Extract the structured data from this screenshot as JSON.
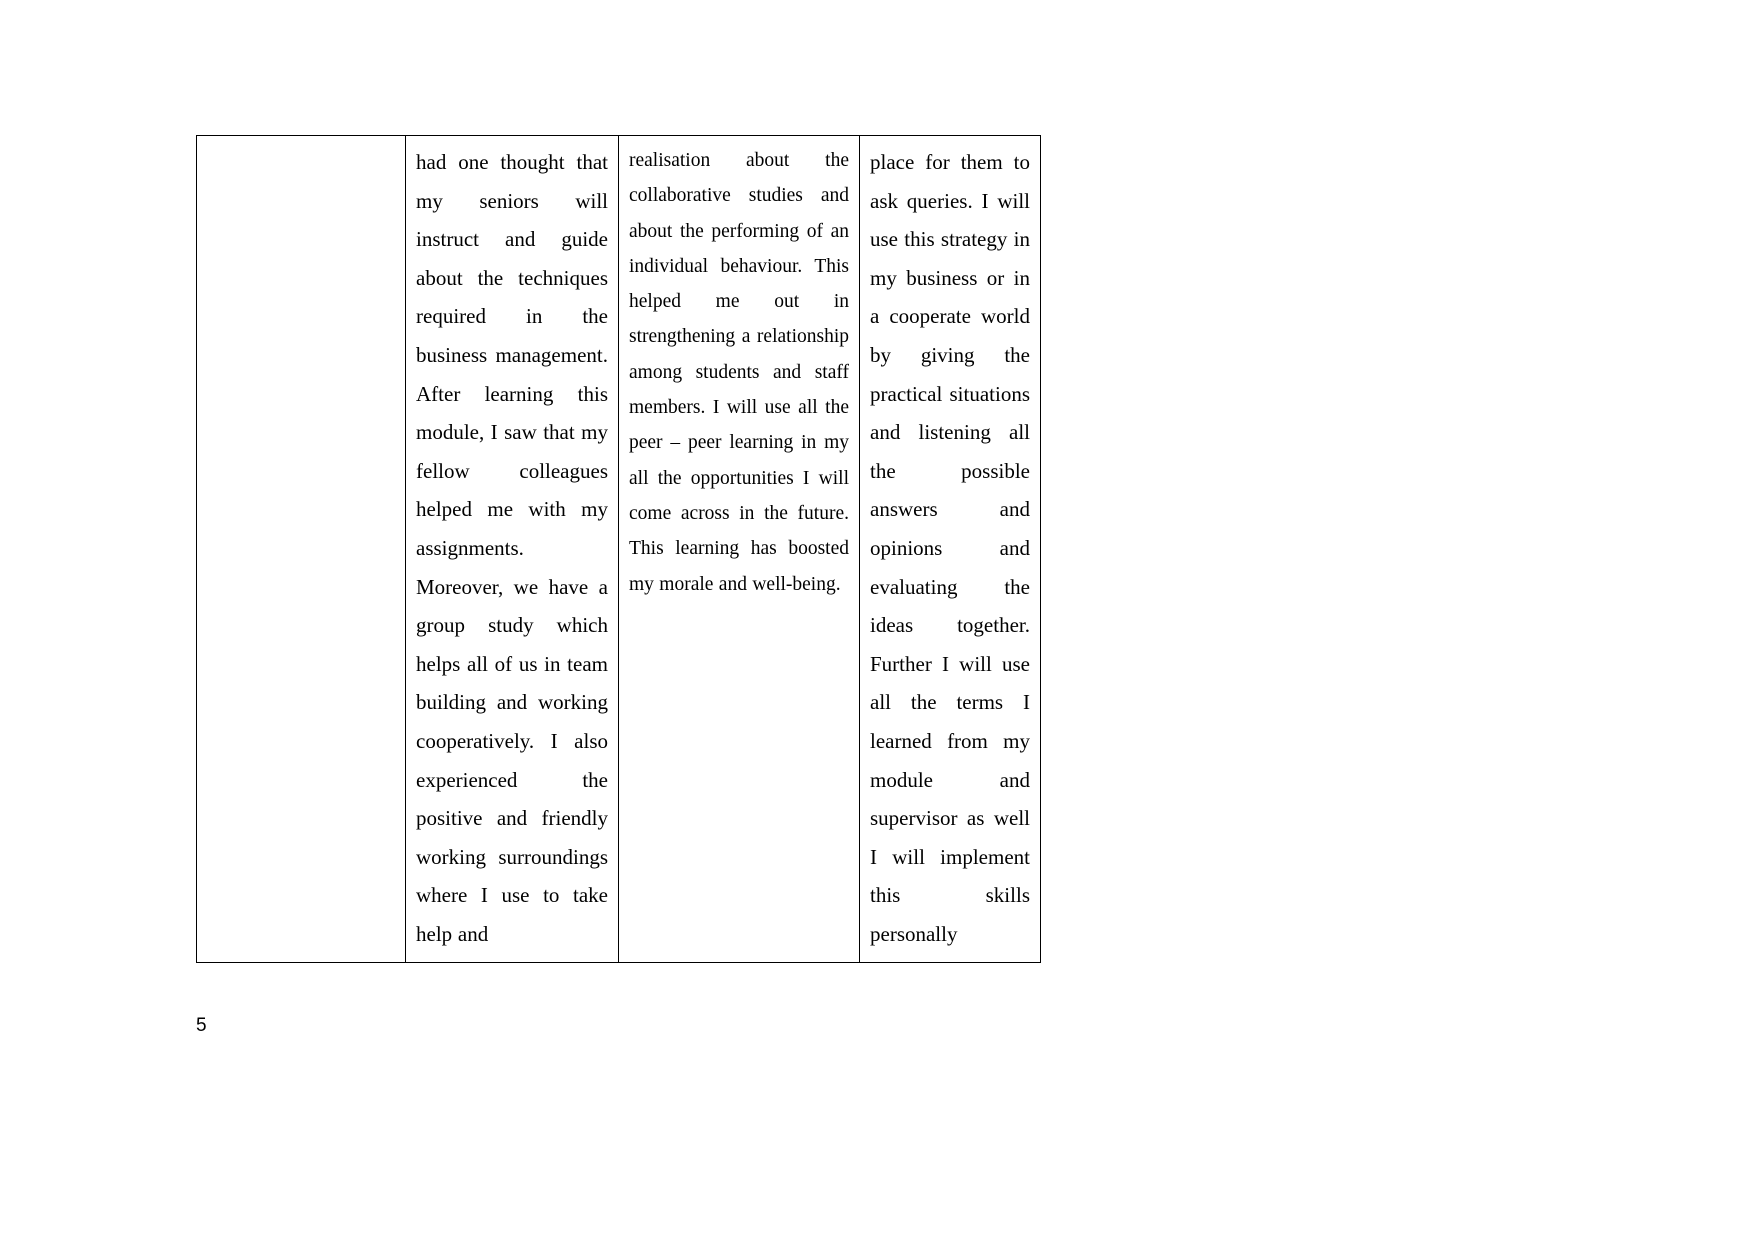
{
  "document": {
    "page_number": "5",
    "table": {
      "columns": [
        {
          "name": "column-empty",
          "text": ""
        },
        {
          "name": "column-learning-experience",
          "text": "had one thought that my seniors will instruct and guide about the techniques required in the business management. After learning this module, I saw that my fellow colleagues helped me with my assignments. Moreover, we have a group study which helps all of us in team building and working cooperatively. I also experienced the positive and friendly working surroundings where I use to take help and"
        },
        {
          "name": "column-realisation",
          "text": "realisation about the collaborative studies and about the performing of an individual behaviour. This helped me out in strengthening a relationship among students and staff members. I will use all the peer – peer learning in my all the opportunities I will come across in the future. This learning has boosted my morale and well-being."
        },
        {
          "name": "column-future-application",
          "text": "place for them to ask queries. I will use this strategy in my business or in a cooperate world by giving the practical situations and listening all the possible answers and opinions and evaluating the ideas together. Further I will use all the terms I learned from my module and supervisor as well I will implement this skills personally"
        }
      ]
    }
  }
}
